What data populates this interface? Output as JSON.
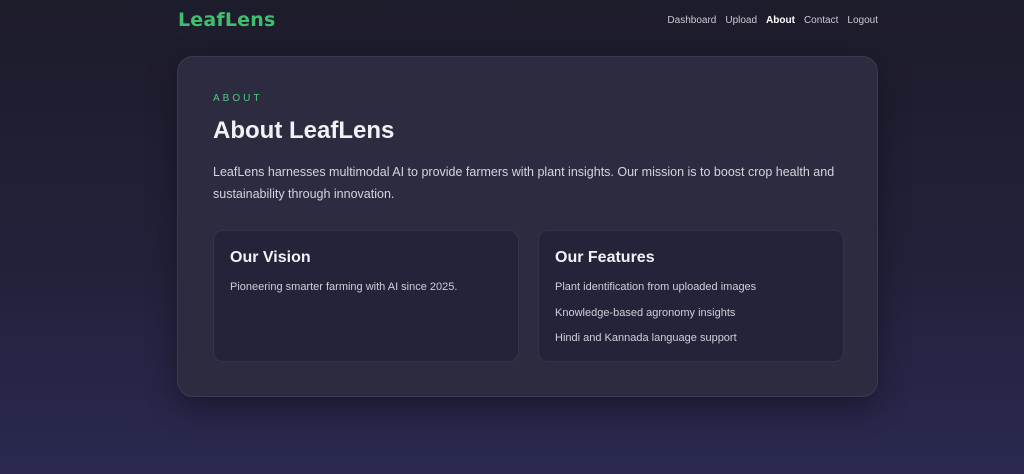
{
  "brand": "LeafLens",
  "nav": {
    "items": [
      {
        "label": "Dashboard"
      },
      {
        "label": "Upload"
      },
      {
        "label": "About"
      },
      {
        "label": "Contact"
      },
      {
        "label": "Logout"
      }
    ],
    "active": "About"
  },
  "about": {
    "eyebrow": "ABOUT",
    "title": "About LeafLens",
    "description": "LeafLens harnesses multimodal AI to provide farmers with plant insights. Our mission is to boost crop health and sustainability through innovation."
  },
  "vision": {
    "title": "Our Vision",
    "text": "Pioneering smarter farming with AI since 2025."
  },
  "features": {
    "title": "Our Features",
    "items": [
      "Plant identification from uploaded images",
      "Knowledge-based agronomy insights",
      "Hindi and Kannada language support"
    ]
  },
  "colors": {
    "brand": "#3fbf6e",
    "accent": "#4ecb80",
    "card_bg": "#2c2b40",
    "panel_bg": "#24233a"
  }
}
